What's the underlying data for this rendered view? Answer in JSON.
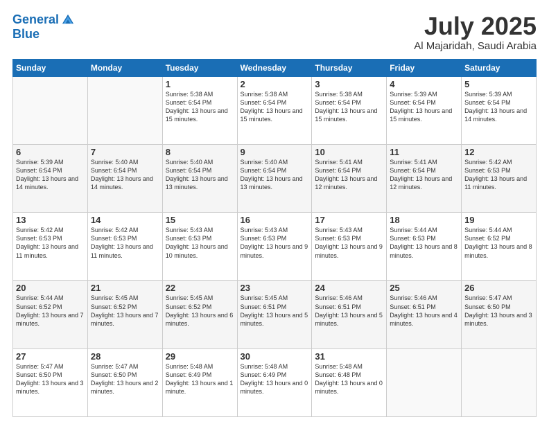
{
  "header": {
    "logo_line1": "General",
    "logo_line2": "Blue",
    "month": "July 2025",
    "location": "Al Majaridah, Saudi Arabia"
  },
  "weekdays": [
    "Sunday",
    "Monday",
    "Tuesday",
    "Wednesday",
    "Thursday",
    "Friday",
    "Saturday"
  ],
  "rows": [
    [
      {
        "day": "",
        "empty": true
      },
      {
        "day": "",
        "empty": true
      },
      {
        "day": "1",
        "sunrise": "5:38 AM",
        "sunset": "6:54 PM",
        "daylight": "13 hours and 15 minutes."
      },
      {
        "day": "2",
        "sunrise": "5:38 AM",
        "sunset": "6:54 PM",
        "daylight": "13 hours and 15 minutes."
      },
      {
        "day": "3",
        "sunrise": "5:38 AM",
        "sunset": "6:54 PM",
        "daylight": "13 hours and 15 minutes."
      },
      {
        "day": "4",
        "sunrise": "5:39 AM",
        "sunset": "6:54 PM",
        "daylight": "13 hours and 15 minutes."
      },
      {
        "day": "5",
        "sunrise": "5:39 AM",
        "sunset": "6:54 PM",
        "daylight": "13 hours and 14 minutes."
      }
    ],
    [
      {
        "day": "6",
        "sunrise": "5:39 AM",
        "sunset": "6:54 PM",
        "daylight": "13 hours and 14 minutes."
      },
      {
        "day": "7",
        "sunrise": "5:40 AM",
        "sunset": "6:54 PM",
        "daylight": "13 hours and 14 minutes."
      },
      {
        "day": "8",
        "sunrise": "5:40 AM",
        "sunset": "6:54 PM",
        "daylight": "13 hours and 13 minutes."
      },
      {
        "day": "9",
        "sunrise": "5:40 AM",
        "sunset": "6:54 PM",
        "daylight": "13 hours and 13 minutes."
      },
      {
        "day": "10",
        "sunrise": "5:41 AM",
        "sunset": "6:54 PM",
        "daylight": "13 hours and 12 minutes."
      },
      {
        "day": "11",
        "sunrise": "5:41 AM",
        "sunset": "6:54 PM",
        "daylight": "13 hours and 12 minutes."
      },
      {
        "day": "12",
        "sunrise": "5:42 AM",
        "sunset": "6:53 PM",
        "daylight": "13 hours and 11 minutes."
      }
    ],
    [
      {
        "day": "13",
        "sunrise": "5:42 AM",
        "sunset": "6:53 PM",
        "daylight": "13 hours and 11 minutes."
      },
      {
        "day": "14",
        "sunrise": "5:42 AM",
        "sunset": "6:53 PM",
        "daylight": "13 hours and 11 minutes."
      },
      {
        "day": "15",
        "sunrise": "5:43 AM",
        "sunset": "6:53 PM",
        "daylight": "13 hours and 10 minutes."
      },
      {
        "day": "16",
        "sunrise": "5:43 AM",
        "sunset": "6:53 PM",
        "daylight": "13 hours and 9 minutes."
      },
      {
        "day": "17",
        "sunrise": "5:43 AM",
        "sunset": "6:53 PM",
        "daylight": "13 hours and 9 minutes."
      },
      {
        "day": "18",
        "sunrise": "5:44 AM",
        "sunset": "6:53 PM",
        "daylight": "13 hours and 8 minutes."
      },
      {
        "day": "19",
        "sunrise": "5:44 AM",
        "sunset": "6:52 PM",
        "daylight": "13 hours and 8 minutes."
      }
    ],
    [
      {
        "day": "20",
        "sunrise": "5:44 AM",
        "sunset": "6:52 PM",
        "daylight": "13 hours and 7 minutes."
      },
      {
        "day": "21",
        "sunrise": "5:45 AM",
        "sunset": "6:52 PM",
        "daylight": "13 hours and 7 minutes."
      },
      {
        "day": "22",
        "sunrise": "5:45 AM",
        "sunset": "6:52 PM",
        "daylight": "13 hours and 6 minutes."
      },
      {
        "day": "23",
        "sunrise": "5:45 AM",
        "sunset": "6:51 PM",
        "daylight": "13 hours and 5 minutes."
      },
      {
        "day": "24",
        "sunrise": "5:46 AM",
        "sunset": "6:51 PM",
        "daylight": "13 hours and 5 minutes."
      },
      {
        "day": "25",
        "sunrise": "5:46 AM",
        "sunset": "6:51 PM",
        "daylight": "13 hours and 4 minutes."
      },
      {
        "day": "26",
        "sunrise": "5:47 AM",
        "sunset": "6:50 PM",
        "daylight": "13 hours and 3 minutes."
      }
    ],
    [
      {
        "day": "27",
        "sunrise": "5:47 AM",
        "sunset": "6:50 PM",
        "daylight": "13 hours and 3 minutes."
      },
      {
        "day": "28",
        "sunrise": "5:47 AM",
        "sunset": "6:50 PM",
        "daylight": "13 hours and 2 minutes."
      },
      {
        "day": "29",
        "sunrise": "5:48 AM",
        "sunset": "6:49 PM",
        "daylight": "13 hours and 1 minute."
      },
      {
        "day": "30",
        "sunrise": "5:48 AM",
        "sunset": "6:49 PM",
        "daylight": "13 hours and 0 minutes."
      },
      {
        "day": "31",
        "sunrise": "5:48 AM",
        "sunset": "6:48 PM",
        "daylight": "13 hours and 0 minutes."
      },
      {
        "day": "",
        "empty": true
      },
      {
        "day": "",
        "empty": true
      }
    ]
  ]
}
